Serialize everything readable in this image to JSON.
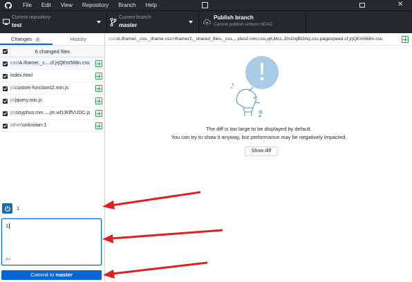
{
  "menu": [
    "File",
    "Edit",
    "View",
    "Repository",
    "Branch",
    "Help"
  ],
  "toolbar": {
    "repo_title": "Current repository",
    "repo_value": "test",
    "branch_title": "Current branch",
    "branch_value": "master",
    "publish_title": "Publish branch",
    "publish_sub": "Cannot publish unborn HEAD"
  },
  "tabs": {
    "changes": "Changes",
    "changes_count": "6",
    "history": "History"
  },
  "changes": {
    "header": "6 changed files",
    "files": [
      {
        "dir": "css\\",
        "name": "A.iframer._c....cf.jrjQEm568n.css"
      },
      {
        "dir": "",
        "name": "index.html"
      },
      {
        "dir": "js\\",
        "name": "custom-functions2.min.js"
      },
      {
        "dir": "js\\",
        "name": "jquery.min.js"
      },
      {
        "dir": "js\\",
        "name": "sisyphus.min.....jm.wDJKffVUDC.js"
      },
      {
        "dir": "other\\",
        "name": "unknown-1"
      }
    ]
  },
  "commit": {
    "summary_value": "1",
    "description_value": "1",
    "coauthor": "A+",
    "button_prefix": "Commit to",
    "button_branch": "master"
  },
  "diff": {
    "path_dir": "css\\",
    "path_name": "A.iframer._css,_iframe.css+iframer2,_shared_files,_css,...yles2.min.css,q6,Mcc.J0sGxjBOAq.css.pagespeed.cf.jrjQEm568n.css",
    "message_line1": "The diff is too large to be displayed by default.",
    "message_line2": "You can try to show it anyway, but performance may be negatively impacted.",
    "show_diff_label": "Show diff"
  },
  "colors": {
    "titlebar": "#24292e",
    "accent": "#0366d6",
    "added": "#28a745",
    "arrow": "#e02020",
    "illustration": "#a8cbe8"
  }
}
